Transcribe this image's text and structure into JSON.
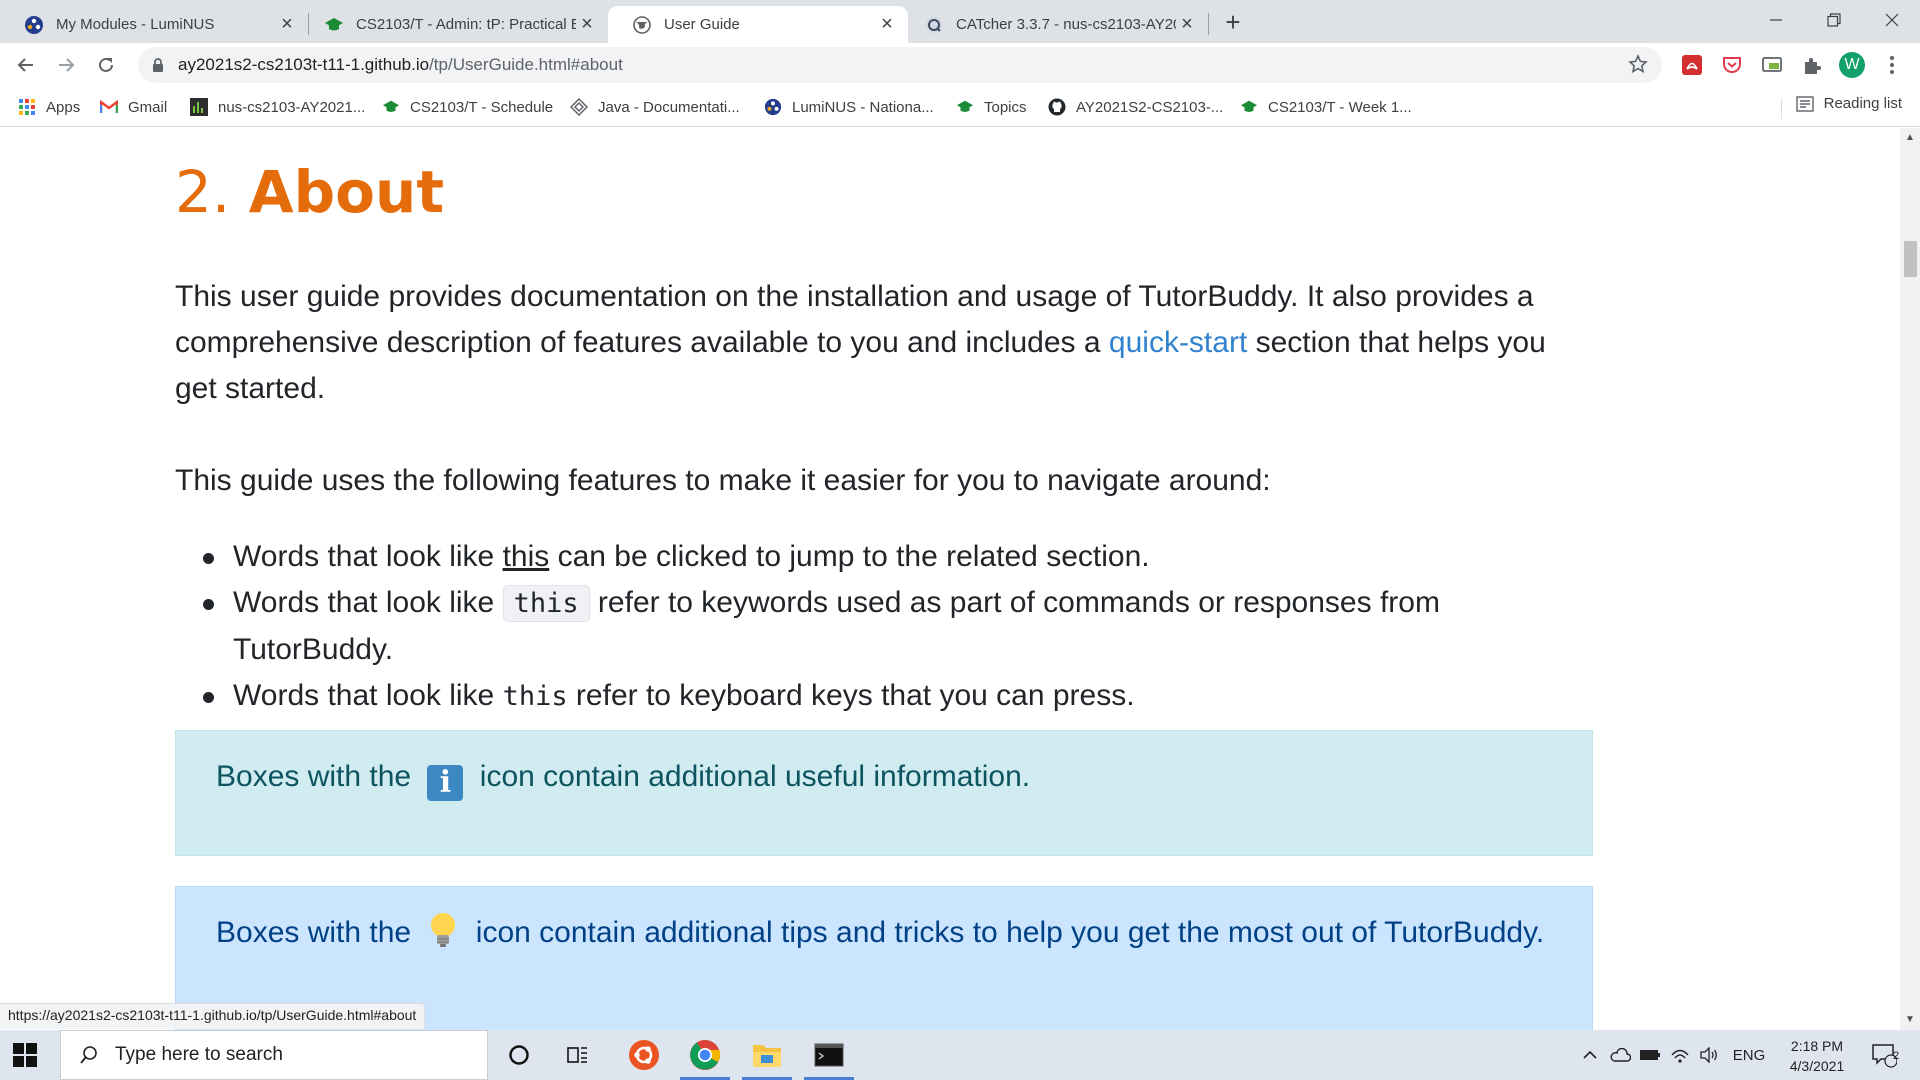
{
  "browser": {
    "tabs": [
      {
        "title": "My Modules - LumiNUS",
        "icon": "luminus-icon",
        "active": false
      },
      {
        "title": "CS2103/T - Admin: tP: Practical E",
        "icon": "graduation-cap-icon",
        "active": false
      },
      {
        "title": "User Guide",
        "icon": "globe-icon",
        "active": true
      },
      {
        "title": "CATcher 3.3.7 - nus-cs2103-AY20",
        "icon": "catcher-icon",
        "active": false
      }
    ],
    "url_host": "ay2021s2-cs2103t-t11-1.github.io",
    "url_path": "/tp/UserGuide.html#about",
    "profile_initial": "W",
    "bookmarks": [
      {
        "label": "Apps",
        "icon": "apps-grid-icon"
      },
      {
        "label": "Gmail",
        "icon": "gmail-icon"
      },
      {
        "label": "nus-cs2103-AY2021...",
        "icon": "chart-bars-icon"
      },
      {
        "label": "CS2103/T - Schedule",
        "icon": "graduation-cap-icon"
      },
      {
        "label": "Java - Documentati...",
        "icon": "java-icon"
      },
      {
        "label": "LumiNUS - Nationa...",
        "icon": "luminus-icon"
      },
      {
        "label": "Topics",
        "icon": "graduation-cap-icon"
      },
      {
        "label": "AY2021S2-CS2103-...",
        "icon": "github-icon"
      },
      {
        "label": "CS2103/T - Week 1...",
        "icon": "graduation-cap-icon"
      }
    ],
    "reading_list": "Reading list",
    "status_url": "https://ay2021s2-cs2103t-t11-1.github.io/tp/UserGuide.html#about"
  },
  "page": {
    "heading_number": "2.",
    "heading_word": "About",
    "intro_before_link": "This user guide provides documentation on the installation and usage of TutorBuddy. It also provides a comprehensive description of features available to you and includes a ",
    "intro_link": "quick-start",
    "intro_after_link": " section that helps you get started.",
    "features_intro": "This guide uses the following features to make it easier for you to navigate around:",
    "bullets": [
      {
        "before": "Words that look like ",
        "sample": "this",
        "after": " can be clicked to jump to the related section."
      },
      {
        "before": "Words that look like ",
        "sample": "this",
        "after": " refer to keywords used as part of commands or responses from TutorBuddy."
      },
      {
        "before": "Words that look like ",
        "sample": "this",
        "after": " refer to keyboard keys that you can press."
      }
    ],
    "info_box": {
      "before": "Boxes with the ",
      "after": " icon contain additional useful information."
    },
    "tip_box": {
      "before": "Boxes with the ",
      "after": " icon contain additional tips and tricks to help you get the most out of TutorBuddy."
    }
  },
  "taskbar": {
    "search_placeholder": "Type here to search",
    "language": "ENG",
    "time": "2:18 PM",
    "date": "4/3/2021",
    "notifications": "2"
  },
  "colors": {
    "heading": "#e46c0a",
    "link": "#3182ce",
    "info_bg": "#d1ecf1",
    "tip_bg": "#cce5ff"
  }
}
